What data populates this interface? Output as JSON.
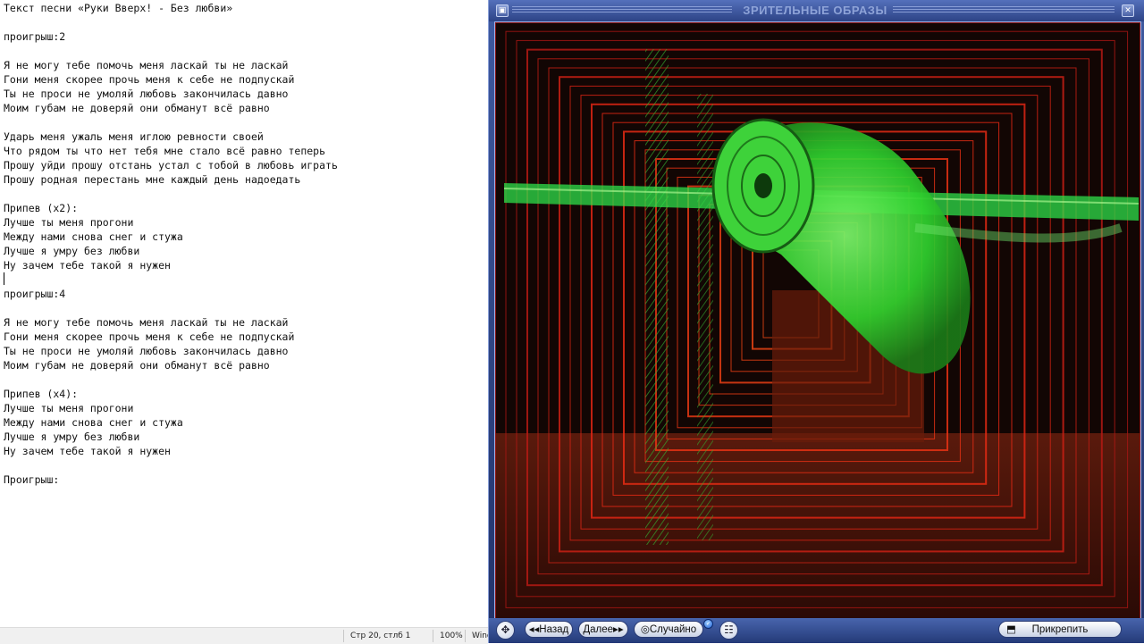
{
  "editor": {
    "lines": [
      "Текст песни «Руки Вверх! - Без любви»",
      "",
      "проигрыш:2",
      "",
      "Я не могу тебе помочь меня ласкай ты не ласкай",
      "Гони меня скорее прочь меня к себе не подпускай",
      "Ты не проси не умоляй любовь закончилась давно",
      "Моим губам не доверяй они обманут всё равно",
      "",
      "Ударь меня ужаль меня иглою ревности своей",
      "Что рядом ты что нет тебя мне стало всё равно теперь",
      "Прошу уйди прошу отстань устал с тобой в любовь играть",
      "Прошу родная перестань мне каждый день надоедать",
      "",
      "Припев (x2):",
      "Лучше ты меня прогони",
      "Между нами снова снег и стужа",
      "Лучше я умру без любви",
      "Ну зачем тебе такой я нужен",
      "",
      "проигрыш:4",
      "",
      "Я не могу тебе помочь меня ласкай ты не ласкай",
      "Гони меня скорее прочь меня к себе не подпускай",
      "Ты не проси не умоляй любовь закончилась давно",
      "Моим губам не доверяй они обманут всё равно",
      "",
      "Припев (x4):",
      "Лучше ты меня прогони",
      "Между нами снова снег и стужа",
      "Лучше я умру без любви",
      "Ну зачем тебе такой я нужен",
      "",
      "Проигрыш:"
    ]
  },
  "statusbar": {
    "position": "Стр 20, стлб 1",
    "zoom": "100%",
    "encoding": "Wind"
  },
  "visualizer": {
    "title": "ЗРИТЕЛЬНЫЕ ОБРАЗЫ",
    "controls": {
      "back_label": "◂◂Назад",
      "next_label": "Далее▸▸",
      "random_label": "Случайно",
      "pin_label": "Прикрепить"
    }
  },
  "colors": {
    "window_blue": "#2d4386",
    "viz_green": "#3be03a",
    "viz_red": "#c8321a"
  }
}
